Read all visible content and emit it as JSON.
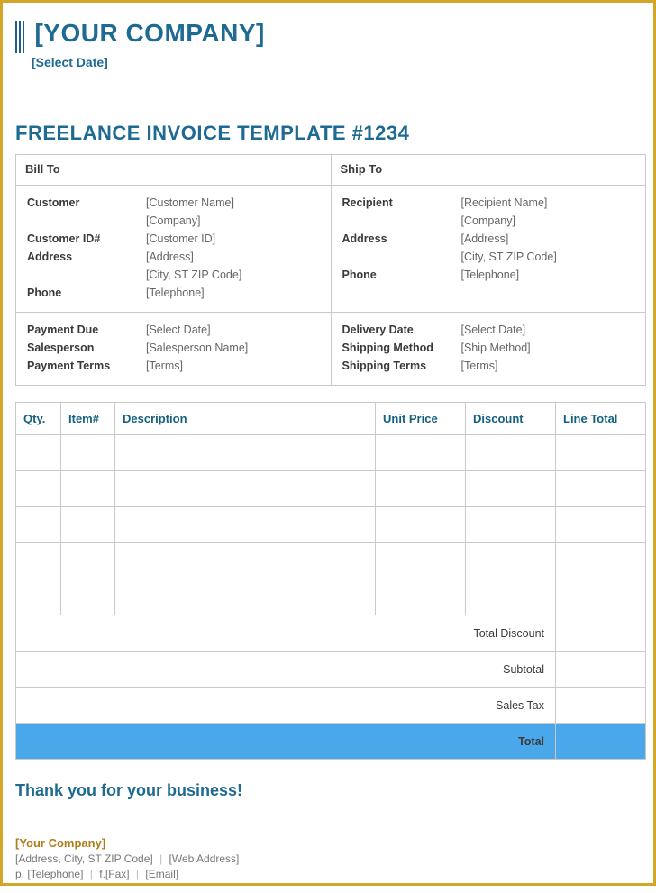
{
  "header": {
    "company_placeholder": "[YOUR COMPANY]",
    "date_placeholder": "[Select Date]"
  },
  "title": "FREELANCE INVOICE TEMPLATE #1234",
  "bill_to": {
    "heading": "Bill To",
    "customer_label": "Customer",
    "customer_name": "[Customer Name]",
    "customer_company": "[Company]",
    "customer_id_label": "Customer ID#",
    "customer_id": "[Customer ID]",
    "address_label": "Address",
    "address_line1": "[Address]",
    "address_line2": "[City, ST  ZIP Code]",
    "phone_label": "Phone",
    "phone": "[Telephone]"
  },
  "ship_to": {
    "heading": "Ship To",
    "recipient_label": "Recipient",
    "recipient_name": "[Recipient Name]",
    "recipient_company": "[Company]",
    "address_label": "Address",
    "address_line1": "[Address]",
    "address_line2": "[City, ST  ZIP Code]",
    "phone_label": "Phone",
    "phone": "[Telephone]"
  },
  "payment": {
    "payment_due_label": "Payment Due",
    "payment_due": "[Select Date]",
    "salesperson_label": "Salesperson",
    "salesperson": "[Salesperson Name]",
    "payment_terms_label": "Payment Terms",
    "payment_terms": "[Terms]"
  },
  "shipping": {
    "delivery_date_label": "Delivery Date",
    "delivery_date": "[Select Date]",
    "shipping_method_label": "Shipping Method",
    "shipping_method": "[Ship Method]",
    "shipping_terms_label": "Shipping Terms",
    "shipping_terms": "[Terms]"
  },
  "items": {
    "columns": {
      "qty": "Qty.",
      "item": "Item#",
      "description": "Description",
      "unit_price": "Unit Price",
      "discount": "Discount",
      "line_total": "Line Total"
    },
    "rows": [
      {
        "qty": "",
        "item": "",
        "description": "",
        "unit_price": "",
        "discount": "",
        "line_total": ""
      },
      {
        "qty": "",
        "item": "",
        "description": "",
        "unit_price": "",
        "discount": "",
        "line_total": ""
      },
      {
        "qty": "",
        "item": "",
        "description": "",
        "unit_price": "",
        "discount": "",
        "line_total": ""
      },
      {
        "qty": "",
        "item": "",
        "description": "",
        "unit_price": "",
        "discount": "",
        "line_total": ""
      },
      {
        "qty": "",
        "item": "",
        "description": "",
        "unit_price": "",
        "discount": "",
        "line_total": ""
      }
    ]
  },
  "totals": {
    "total_discount_label": "Total Discount",
    "total_discount": "",
    "subtotal_label": "Subtotal",
    "subtotal": "",
    "sales_tax_label": "Sales Tax",
    "sales_tax": "",
    "total_label": "Total",
    "total": ""
  },
  "thanks": "Thank you for your business!",
  "footer": {
    "company": "[Your Company]",
    "address": "[Address, City, ST  ZIP Code]",
    "web": "[Web Address]",
    "phone_prefix": "p.",
    "phone": "[Telephone]",
    "fax_prefix": "f.",
    "fax": "[Fax]",
    "email": "[Email]",
    "sep": "|"
  }
}
